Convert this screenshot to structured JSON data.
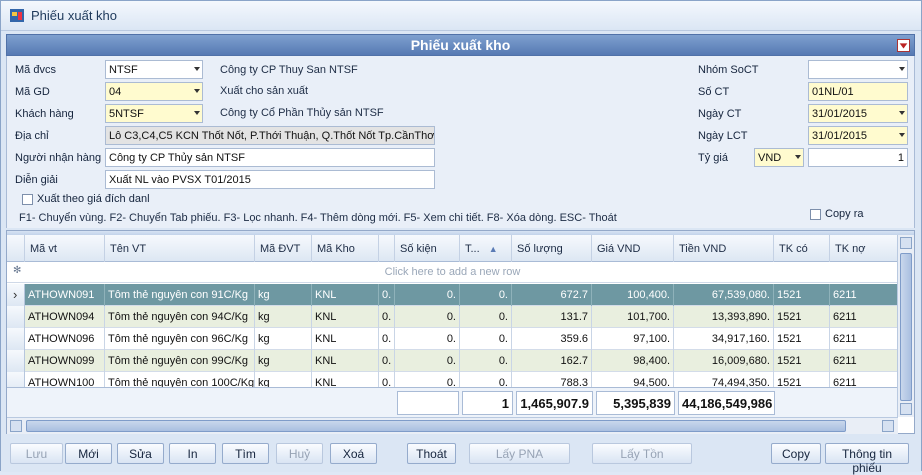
{
  "window": {
    "title": "Phiếu xuất kho"
  },
  "header": {
    "title": "Phiếu xuất kho"
  },
  "form": {
    "ma_dvcs": {
      "label": "Mã đvcs",
      "value": "NTSF",
      "desc": "Công ty CP Thuy San NTSF"
    },
    "ma_gd": {
      "label": "Mã GD",
      "value": "04",
      "desc": "Xuất cho sản xuất"
    },
    "khach_hang": {
      "label": "Khách hàng",
      "value": "5NTSF",
      "desc": "Công ty Cổ Phần Thủy sản NTSF"
    },
    "dia_chi": {
      "label": "Địa chỉ",
      "value": "Lô C3,C4,C5 KCN Thốt Nốt, P.Thới Thuận, Q.Thốt Nốt Tp.CầnThơ"
    },
    "nguoi_nhan": {
      "label": "Người nhận hàng",
      "value": "Công ty CP Thủy sản NTSF"
    },
    "dien_giai": {
      "label": "Diễn giải",
      "value": "Xuất NL vào PVSX T01/2015"
    },
    "xuat_theo_gia": {
      "label": "Xuất theo giá đích danl",
      "checked": false
    },
    "nhom_soct": {
      "label": "Nhóm SoCT",
      "value": ""
    },
    "so_ct": {
      "label": "Số CT",
      "value": "01NL/01"
    },
    "ngay_ct": {
      "label": "Ngày CT",
      "value": "31/01/2015"
    },
    "ngay_lct": {
      "label": "Ngày LCT",
      "value": "31/01/2015"
    },
    "ty_gia": {
      "label": "Tỷ giá",
      "currency": "VND",
      "value": "1"
    },
    "copy_ra": {
      "label": "Copy ra",
      "checked": false
    },
    "shortcuts": "F1- Chuyển vùng. F2- Chuyển Tab phiếu. F3- Lọc nhanh. F4- Thêm dòng mới. F5- Xem chi tiết. F8- Xóa dòng. ESC- Thoát"
  },
  "grid": {
    "columns": [
      "Mã vt",
      "Tên VT",
      "Mã ĐVT",
      "Mã Kho",
      "",
      "Số kiện",
      "T...",
      "Số lượng",
      "Giá VND",
      "Tiền VND",
      "TK có",
      "TK nợ"
    ],
    "add_row_text": "Click here to add a new row",
    "rows": [
      {
        "ma_vt": "ATHOWN091",
        "ten_vt": "Tôm thẻ nguyên con 91C/Kg",
        "dvt": "kg",
        "kho": "KNL",
        "c5": "0.",
        "so_kien": "0.",
        "t": "0.",
        "so_luong": "672.7",
        "gia": "100,400.",
        "tien": "67,539,080.",
        "tk_co": "1521",
        "tk_no": "6211"
      },
      {
        "ma_vt": "ATHOWN094",
        "ten_vt": "Tôm thẻ nguyên con 94C/Kg",
        "dvt": "kg",
        "kho": "KNL",
        "c5": "0.",
        "so_kien": "0.",
        "t": "0.",
        "so_luong": "131.7",
        "gia": "101,700.",
        "tien": "13,393,890.",
        "tk_co": "1521",
        "tk_no": "6211"
      },
      {
        "ma_vt": "ATHOWN096",
        "ten_vt": "Tôm thẻ nguyên con 96C/Kg",
        "dvt": "kg",
        "kho": "KNL",
        "c5": "0.",
        "so_kien": "0.",
        "t": "0.",
        "so_luong": "359.6",
        "gia": "97,100.",
        "tien": "34,917,160.",
        "tk_co": "1521",
        "tk_no": "6211"
      },
      {
        "ma_vt": "ATHOWN099",
        "ten_vt": "Tôm thẻ nguyên con 99C/Kg",
        "dvt": "kg",
        "kho": "KNL",
        "c5": "0.",
        "so_kien": "0.",
        "t": "0.",
        "so_luong": "162.7",
        "gia": "98,400.",
        "tien": "16,009,680.",
        "tk_co": "1521",
        "tk_no": "6211"
      },
      {
        "ma_vt": "ATHOWN100",
        "ten_vt": "Tôm thẻ nguyên con 100C/Kg",
        "dvt": "kg",
        "kho": "KNL",
        "c5": "0.",
        "so_kien": "0.",
        "t": "0.",
        "so_luong": "788.3",
        "gia": "94,500.",
        "tien": "74,494,350.",
        "tk_co": "1521",
        "tk_no": "6211"
      }
    ],
    "totals": {
      "so_kien": "",
      "t": "1",
      "so_luong": "1,465,907.9",
      "gia": "5,395,839",
      "tien": "44,186,549,986"
    }
  },
  "toolbar": {
    "luu": "Lưu",
    "moi": "Mới",
    "sua": "Sửa",
    "in": "In",
    "tim": "Tìm",
    "huy": "Huỷ",
    "xoa": "Xoá",
    "thoat": "Thoát",
    "lay_pna": "Lấy PNA",
    "lay_ton": "Lấy Tồn",
    "copy": "Copy",
    "thong_tin": "Thông tin phiếu"
  }
}
